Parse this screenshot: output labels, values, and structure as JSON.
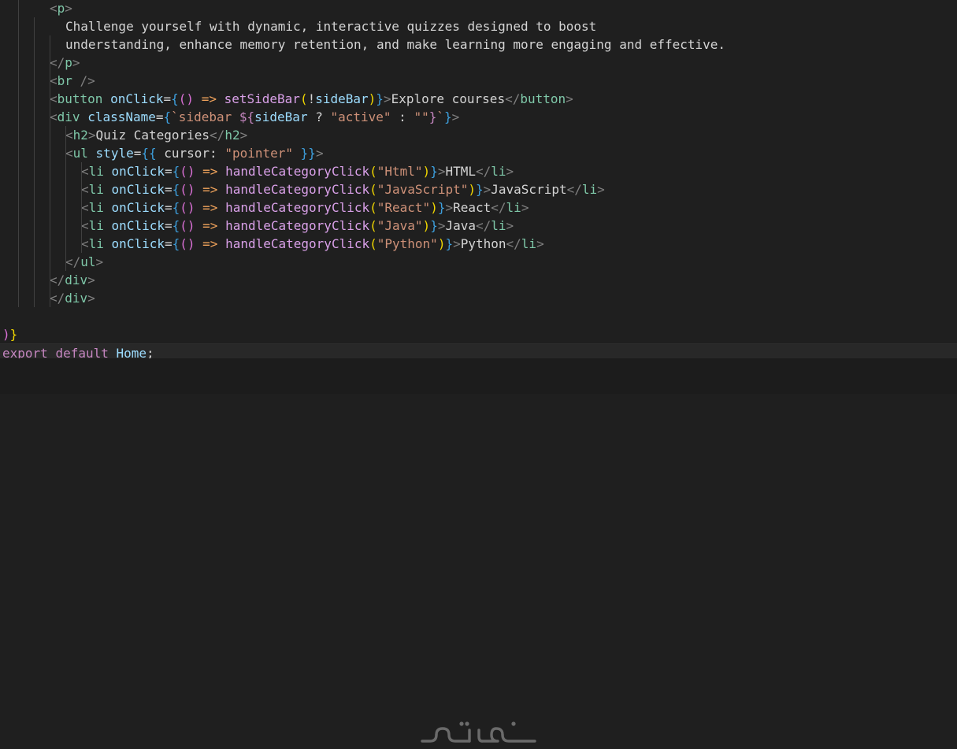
{
  "editor": {
    "colors": {
      "background": "#1f1f1f",
      "tag_punct": "#808080",
      "tag_name": "#7fc8a9",
      "attribute": "#9cdcfe",
      "brace": "#f1d700",
      "brace2": "#3d9fdd",
      "paren": "#da70d6",
      "function": "#d9a0e8",
      "keyword": "#c586c0",
      "operator": "#f2a45c",
      "string": "#ce9178",
      "text": "#d4d4d4",
      "identifier": "#9cdcfe"
    },
    "lines": [
      {
        "indent": 3,
        "tokens": [
          [
            "<",
            "p"
          ],
          [
            "p",
            "t"
          ],
          [
            ">",
            "p"
          ]
        ]
      },
      {
        "indent": 4,
        "tokens": [
          [
            "Challenge yourself with dynamic, interactive quizzes designed to boost",
            "x"
          ]
        ]
      },
      {
        "indent": 4,
        "tokens": [
          [
            "understanding, enhance memory retention, and make learning more engaging and effective.",
            "x"
          ]
        ]
      },
      {
        "indent": 3,
        "tokens": [
          [
            "</",
            "p"
          ],
          [
            "p",
            "t"
          ],
          [
            ">",
            "p"
          ]
        ]
      },
      {
        "indent": 3,
        "tokens": [
          [
            "<",
            "p"
          ],
          [
            "br",
            "t"
          ],
          [
            " />",
            "p"
          ]
        ]
      },
      {
        "indent": 3,
        "tokens": [
          [
            "<",
            "p"
          ],
          [
            "button",
            "t"
          ],
          [
            " ",
            "x"
          ],
          [
            "onClick",
            "a"
          ],
          [
            "=",
            "x"
          ],
          [
            "{",
            "b2"
          ],
          [
            "()",
            "pr"
          ],
          [
            " ",
            "x"
          ],
          [
            "=>",
            "op"
          ],
          [
            " ",
            "x"
          ],
          [
            "setSideBar",
            "f"
          ],
          [
            "(",
            "b"
          ],
          [
            "!",
            "x"
          ],
          [
            "sideBar",
            "id"
          ],
          [
            ")",
            "b"
          ],
          [
            "}",
            "b2"
          ],
          [
            ">",
            "p"
          ],
          [
            "Explore courses",
            "x"
          ],
          [
            "</",
            "p"
          ],
          [
            "button",
            "t"
          ],
          [
            ">",
            "p"
          ]
        ]
      },
      {
        "indent": 3,
        "tokens": [
          [
            "<",
            "p"
          ],
          [
            "div",
            "t"
          ],
          [
            " ",
            "x"
          ],
          [
            "className",
            "a"
          ],
          [
            "=",
            "x"
          ],
          [
            "{",
            "b2"
          ],
          [
            "`sidebar ",
            "s"
          ],
          [
            "${",
            "kw"
          ],
          [
            "sideBar",
            "id"
          ],
          [
            " ? ",
            "x"
          ],
          [
            "\"active\"",
            "s"
          ],
          [
            " : ",
            "x"
          ],
          [
            "\"\"",
            "s"
          ],
          [
            "}",
            "kw"
          ],
          [
            "`",
            "s"
          ],
          [
            "}",
            "b2"
          ],
          [
            ">",
            "p"
          ]
        ]
      },
      {
        "indent": 4,
        "tokens": [
          [
            "<",
            "p"
          ],
          [
            "h2",
            "t"
          ],
          [
            ">",
            "p"
          ],
          [
            "Quiz Categories",
            "x"
          ],
          [
            "</",
            "p"
          ],
          [
            "h2",
            "t"
          ],
          [
            ">",
            "p"
          ]
        ]
      },
      {
        "indent": 4,
        "tokens": [
          [
            "<",
            "p"
          ],
          [
            "ul",
            "t"
          ],
          [
            " ",
            "x"
          ],
          [
            "style",
            "a"
          ],
          [
            "=",
            "x"
          ],
          [
            "{{",
            "b2"
          ],
          [
            " cursor: ",
            "x"
          ],
          [
            "\"pointer\"",
            "s"
          ],
          [
            " ",
            "x"
          ],
          [
            "}}",
            "b2"
          ],
          [
            ">",
            "p"
          ]
        ]
      },
      {
        "indent": 5,
        "tokens": [
          [
            "<",
            "p"
          ],
          [
            "li",
            "t"
          ],
          [
            " ",
            "x"
          ],
          [
            "onClick",
            "a"
          ],
          [
            "=",
            "x"
          ],
          [
            "{",
            "b2"
          ],
          [
            "()",
            "pr"
          ],
          [
            " ",
            "x"
          ],
          [
            "=>",
            "op"
          ],
          [
            " ",
            "x"
          ],
          [
            "handleCategoryClick",
            "f"
          ],
          [
            "(",
            "b"
          ],
          [
            "\"Html\"",
            "s"
          ],
          [
            ")",
            "b"
          ],
          [
            "}",
            "b2"
          ],
          [
            ">",
            "p"
          ],
          [
            "HTML",
            "x"
          ],
          [
            "</",
            "p"
          ],
          [
            "li",
            "t"
          ],
          [
            ">",
            "p"
          ]
        ]
      },
      {
        "indent": 5,
        "tokens": [
          [
            "<",
            "p"
          ],
          [
            "li",
            "t"
          ],
          [
            " ",
            "x"
          ],
          [
            "onClick",
            "a"
          ],
          [
            "=",
            "x"
          ],
          [
            "{",
            "b2"
          ],
          [
            "()",
            "pr"
          ],
          [
            " ",
            "x"
          ],
          [
            "=>",
            "op"
          ],
          [
            " ",
            "x"
          ],
          [
            "handleCategoryClick",
            "f"
          ],
          [
            "(",
            "b"
          ],
          [
            "\"JavaScript\"",
            "s"
          ],
          [
            ")",
            "b"
          ],
          [
            "}",
            "b2"
          ],
          [
            ">",
            "p"
          ],
          [
            "JavaScript",
            "x"
          ],
          [
            "</",
            "p"
          ],
          [
            "li",
            "t"
          ],
          [
            ">",
            "p"
          ]
        ]
      },
      {
        "indent": 5,
        "tokens": [
          [
            "<",
            "p"
          ],
          [
            "li",
            "t"
          ],
          [
            " ",
            "x"
          ],
          [
            "onClick",
            "a"
          ],
          [
            "=",
            "x"
          ],
          [
            "{",
            "b2"
          ],
          [
            "()",
            "pr"
          ],
          [
            " ",
            "x"
          ],
          [
            "=>",
            "op"
          ],
          [
            " ",
            "x"
          ],
          [
            "handleCategoryClick",
            "f"
          ],
          [
            "(",
            "b"
          ],
          [
            "\"React\"",
            "s"
          ],
          [
            ")",
            "b"
          ],
          [
            "}",
            "b2"
          ],
          [
            ">",
            "p"
          ],
          [
            "React",
            "x"
          ],
          [
            "</",
            "p"
          ],
          [
            "li",
            "t"
          ],
          [
            ">",
            "p"
          ]
        ]
      },
      {
        "indent": 5,
        "tokens": [
          [
            "<",
            "p"
          ],
          [
            "li",
            "t"
          ],
          [
            " ",
            "x"
          ],
          [
            "onClick",
            "a"
          ],
          [
            "=",
            "x"
          ],
          [
            "{",
            "b2"
          ],
          [
            "()",
            "pr"
          ],
          [
            " ",
            "x"
          ],
          [
            "=>",
            "op"
          ],
          [
            " ",
            "x"
          ],
          [
            "handleCategoryClick",
            "f"
          ],
          [
            "(",
            "b"
          ],
          [
            "\"Java\"",
            "s"
          ],
          [
            ")",
            "b"
          ],
          [
            "}",
            "b2"
          ],
          [
            ">",
            "p"
          ],
          [
            "Java",
            "x"
          ],
          [
            "</",
            "p"
          ],
          [
            "li",
            "t"
          ],
          [
            ">",
            "p"
          ]
        ]
      },
      {
        "indent": 5,
        "tokens": [
          [
            "<",
            "p"
          ],
          [
            "li",
            "t"
          ],
          [
            " ",
            "x"
          ],
          [
            "onClick",
            "a"
          ],
          [
            "=",
            "x"
          ],
          [
            "{",
            "b2"
          ],
          [
            "()",
            "pr"
          ],
          [
            " ",
            "x"
          ],
          [
            "=>",
            "op"
          ],
          [
            " ",
            "x"
          ],
          [
            "handleCategoryClick",
            "f"
          ],
          [
            "(",
            "b"
          ],
          [
            "\"Python\"",
            "s"
          ],
          [
            ")",
            "b"
          ],
          [
            "}",
            "b2"
          ],
          [
            ">",
            "p"
          ],
          [
            "Python",
            "x"
          ],
          [
            "</",
            "p"
          ],
          [
            "li",
            "t"
          ],
          [
            ">",
            "p"
          ]
        ]
      },
      {
        "indent": 4,
        "tokens": [
          [
            "</",
            "p"
          ],
          [
            "ul",
            "t"
          ],
          [
            ">",
            "p"
          ]
        ]
      },
      {
        "indent": 3,
        "tokens": [
          [
            "</",
            "p"
          ],
          [
            "div",
            "t"
          ],
          [
            ">",
            "p"
          ]
        ]
      },
      {
        "indent": 3,
        "tokens": [
          [
            "</",
            "p"
          ],
          [
            "div",
            "t"
          ],
          [
            ">",
            "p"
          ]
        ]
      },
      {
        "indent": 0,
        "tokens": []
      },
      {
        "indent": 0,
        "tokens": [
          [
            ")",
            "pr"
          ],
          [
            "}",
            "b"
          ]
        ]
      },
      {
        "indent": 0,
        "current": true,
        "tokens": [
          [
            "export",
            "kw"
          ],
          [
            " ",
            "x"
          ],
          [
            "default",
            "kw"
          ],
          [
            " ",
            "x"
          ],
          [
            "Home",
            "id"
          ],
          [
            ";",
            "x"
          ]
        ]
      }
    ]
  },
  "watermark": {
    "text": "خمسات",
    "icon": "khamsat-logo-icon",
    "color": "#6b6b6b"
  }
}
